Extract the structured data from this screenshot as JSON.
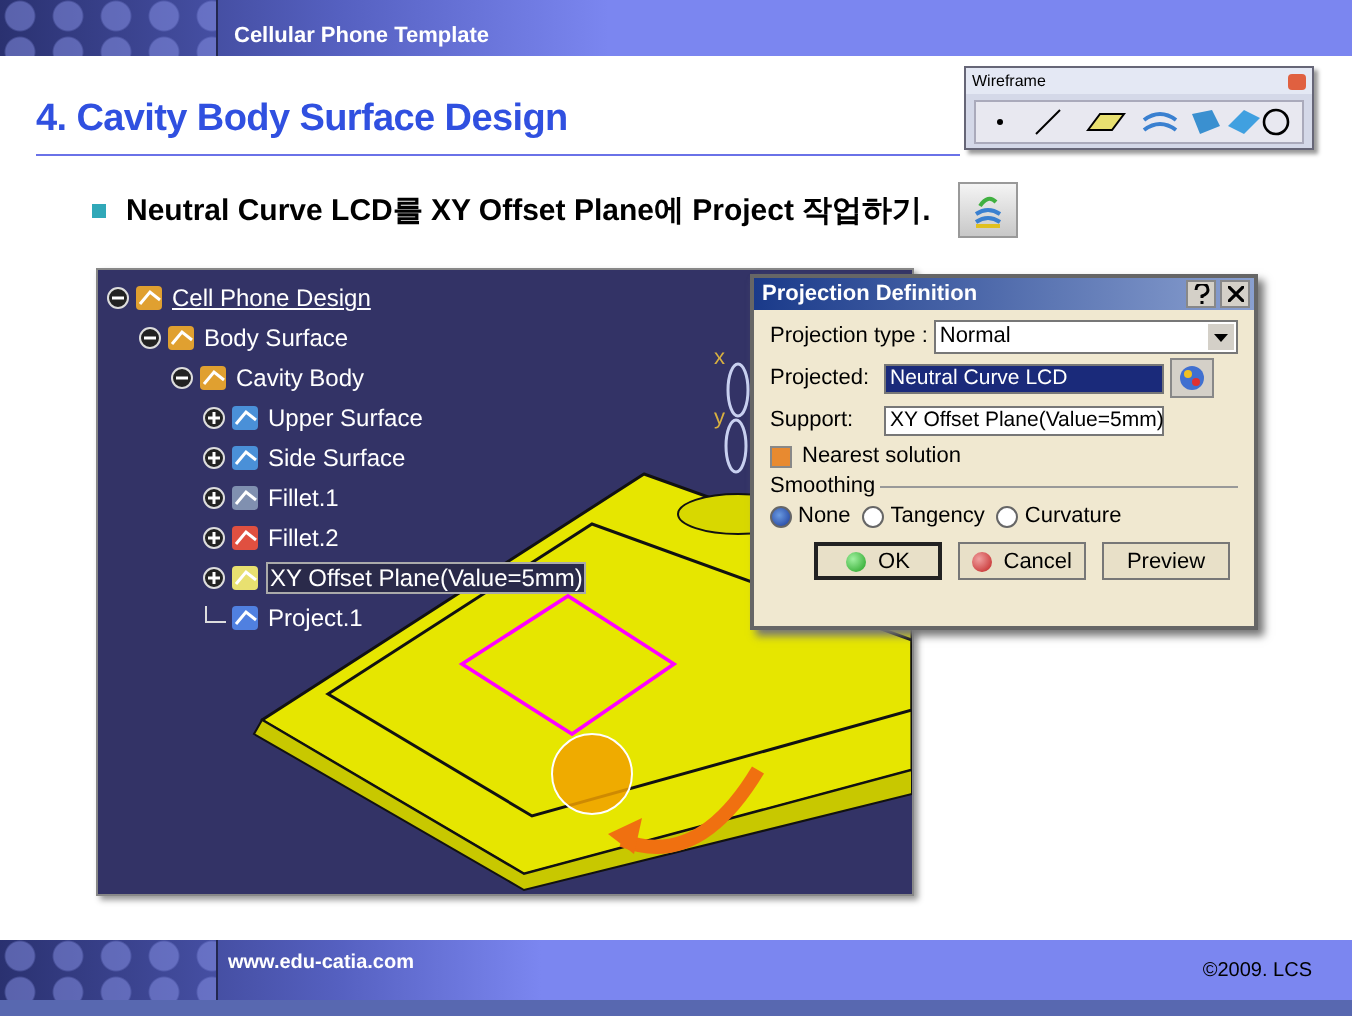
{
  "header": {
    "title": "Cellular Phone Template"
  },
  "slide": {
    "heading": "4. Cavity Body Surface Design",
    "bullet": "Neutral Curve LCD를 XY Offset Plane에 Project 작업하기."
  },
  "toolbar": {
    "title": "Wireframe"
  },
  "tree": [
    {
      "label": "Cell Phone Design",
      "kind": "product",
      "expanded": true,
      "selected": false,
      "children": [
        {
          "label": "Body Surface",
          "kind": "body",
          "expanded": true,
          "selected": false,
          "children": [
            {
              "label": "Cavity Body",
              "kind": "body",
              "expanded": true,
              "selected": false,
              "children": [
                {
                  "label": "Upper Surface",
                  "kind": "surface",
                  "expanded": false,
                  "selected": false
                },
                {
                  "label": "Side Surface",
                  "kind": "surface",
                  "expanded": false,
                  "selected": false
                },
                {
                  "label": "Fillet.1",
                  "kind": "fillet",
                  "expanded": false,
                  "selected": false
                },
                {
                  "label": "Fillet.2",
                  "kind": "fillet2",
                  "expanded": false,
                  "selected": false
                },
                {
                  "label": "XY Offset Plane(Value=5mm)",
                  "kind": "plane",
                  "expanded": false,
                  "selected": true
                },
                {
                  "label": "Project.1",
                  "kind": "project",
                  "selected": false
                }
              ]
            }
          ]
        }
      ]
    }
  ],
  "axis_labels": [
    "x",
    "y"
  ],
  "dialog": {
    "title": "Projection Definition",
    "projection_type": {
      "label": "Projection type :",
      "value": "Normal"
    },
    "projected": {
      "label": "Projected:",
      "value": "Neutral Curve LCD",
      "selected": true
    },
    "support": {
      "label": "Support:",
      "value": "XY Offset Plane(Value=5mm)",
      "selected": false
    },
    "nearest_solution": {
      "label": "Nearest solution",
      "checked": true
    },
    "smoothing": {
      "label": "Smoothing",
      "options": [
        {
          "label": "None",
          "selected": true
        },
        {
          "label": "Tangency",
          "selected": false
        },
        {
          "label": "Curvature",
          "selected": false
        }
      ]
    },
    "buttons": [
      {
        "label": "OK",
        "kind": "ok"
      },
      {
        "label": "Cancel",
        "kind": "cancel"
      },
      {
        "label": "Preview",
        "kind": "plain"
      }
    ]
  },
  "footer": {
    "url": "www.edu-catia.com",
    "copyright": "©2009. LCS"
  }
}
